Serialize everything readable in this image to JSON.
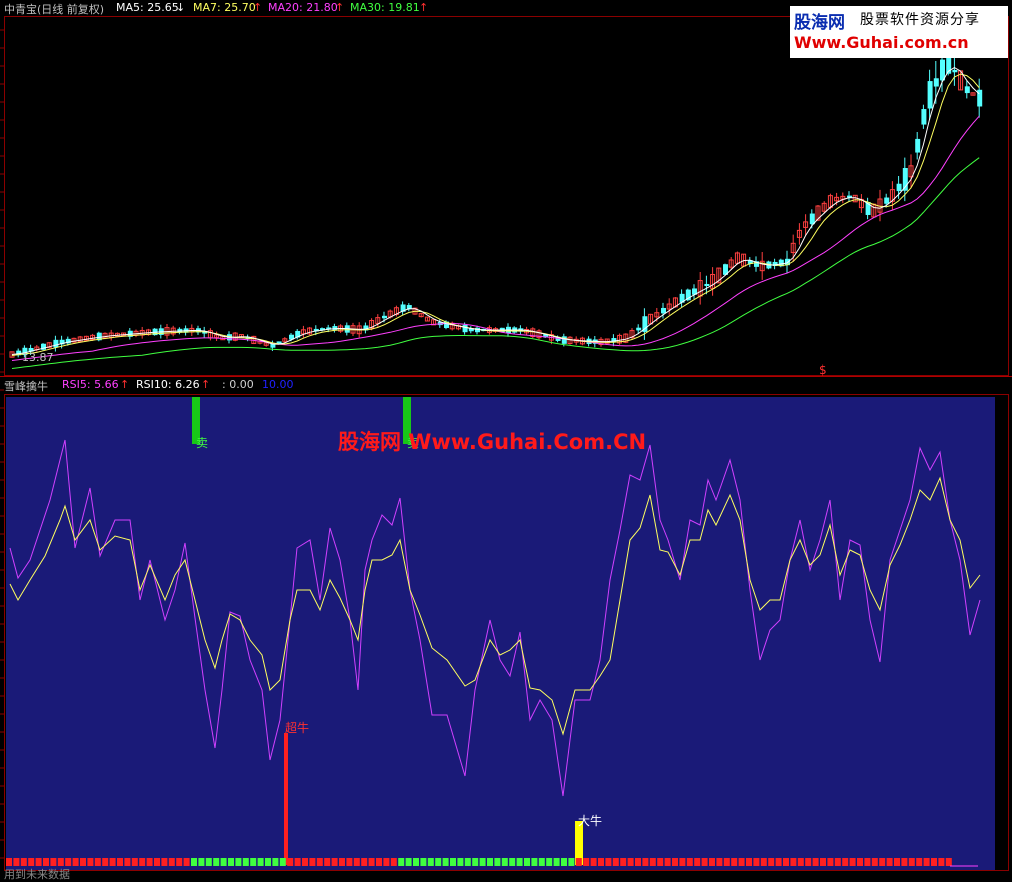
{
  "main_header": {
    "stock": "中青宝(日线 前复权)",
    "ma5": "MA5: 25.65",
    "ma5_arrow": "↓",
    "ma7": "MA7: 25.70",
    "ma7_arrow": "↑",
    "ma20": "MA20: 21.80",
    "ma20_arrow": "↑",
    "ma30": "MA30: 19.81",
    "ma30_arrow": "↑",
    "low_label": "13.87",
    "dollar_marker": "$"
  },
  "logo": {
    "name": "股海网",
    "slogan": "股票软件资源分享",
    "url": "Www.Guhai.com.cn"
  },
  "indicator_header": {
    "name": "雪峰擒牛",
    "rsi5": "RSI5: 5.66",
    "rsi5_arrow": "↑",
    "rsi10": "RSI10: 6.26",
    "rsi10_arrow": "↑",
    "val1": ": 0.00",
    "val2": "10.00"
  },
  "watermark": "股海网 Www.Guhai.Com.CN",
  "signals": {
    "sell": "卖",
    "super_bull": "超牛",
    "big_bull": "大牛"
  },
  "status_bar": "用到未来数据",
  "colors": {
    "background": "#000000",
    "indicator_bg": "#1a1a78",
    "candle_up": "#ff4040",
    "candle_down": "#54ffff",
    "ma5": "#ffffff",
    "ma7": "#ffff60",
    "ma20": "#ff40ff",
    "ma30": "#40ff40",
    "rsi5": "#d040ff",
    "rsi10": "#ffff60"
  }
}
